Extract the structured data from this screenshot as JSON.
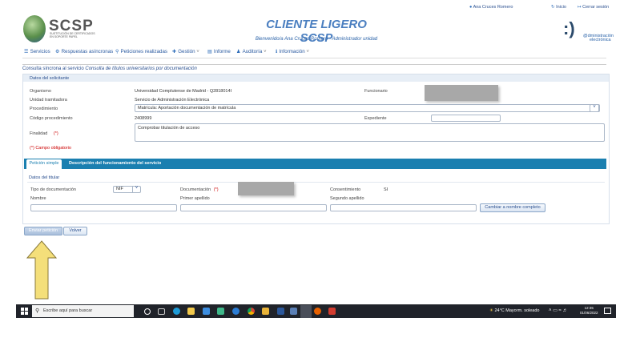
{
  "header": {
    "logo_text": "SCSP",
    "logo_subtitle": "SUSTITUCIÓN DE CERTIFICADOS EN SOPORTE PAPEL",
    "title": "CLIENTE LIGERO SCSP",
    "welcome": "Bienvenido/a Ana Cruces Romero - Administrador unidad",
    "user_name": "Ana Cruces Romero",
    "inicio": "Inicio",
    "cerrar_sesion": "Cerrar sesión",
    "admin_logo_line1": "@dministración",
    "admin_logo_line2": "electrónica",
    "smile": ":)"
  },
  "nav": {
    "items": [
      {
        "label": "Servicios",
        "icon": "list-icon"
      },
      {
        "label": "Respuestas asíncronas",
        "icon": "gear-icon"
      },
      {
        "label": "Peticiones realizadas",
        "icon": "search-icon"
      },
      {
        "label": "Gestión",
        "icon": "plus-icon"
      },
      {
        "label": "Informe",
        "icon": "document-icon"
      },
      {
        "label": "Auditoría",
        "icon": "user-icon"
      },
      {
        "label": "Información",
        "icon": "info-icon"
      }
    ]
  },
  "breadcrumb": {
    "prefix": "Consulta síncrona al servicio ",
    "service": "Consulta de títulos universitarios por documentación"
  },
  "solicitante": {
    "header": "Datos del solicitante",
    "organismo_label": "Organismo",
    "organismo_value": "Universidad Complutense de Madrid - Q2818014I",
    "funcionario_label": "Funcionario",
    "unidad_label": "Unidad tramitadora",
    "unidad_value": "Servicio de Administración Electrónica",
    "procedimiento_label": "Procedimiento",
    "procedimiento_value": "Matrícula: Aportación documentación de matrícula",
    "codigo_label": "Código procedimiento",
    "codigo_value": "2408999",
    "expediente_label": "Expediente",
    "expediente_value": "",
    "finalidad_label": "Finalidad",
    "finalidad_req": "(*)",
    "finalidad_value": "Comprobar titulación de acceso",
    "required_note": "(*) Campo obligatorio"
  },
  "tabs": [
    {
      "label": "Petición simple",
      "active": true
    },
    {
      "label": "Descripción del funcionamiento del servicio",
      "active": false
    }
  ],
  "titular": {
    "header": "Datos del titular",
    "tipo_doc_label": "Tipo de documentación",
    "tipo_doc_value": "NIF",
    "documentacion_label": "Documentación",
    "documentacion_req": "(*)",
    "consentimiento_label": "Consentimiento",
    "consentimiento_value": "SI",
    "nombre_label": "Nombre",
    "nombre_value": "",
    "primer_apellido_label": "Primer apellido",
    "primer_apellido_value": "",
    "segundo_apellido_label": "Segundo apellido",
    "segundo_apellido_value": "",
    "cambiar_btn": "Cambiar a nombre completo"
  },
  "actions": {
    "enviar": "Enviar petición",
    "volver": "Volver"
  },
  "taskbar": {
    "search_placeholder": "Escribe aquí para buscar",
    "weather": "24°C  Mayorm. soleado",
    "time": "12:35",
    "date": "01/06/2022"
  },
  "colors": {
    "accent": "#1a7fb0",
    "brand_blue": "#4b7fc0",
    "required": "#cc0000",
    "arrow": "#f4df7a"
  }
}
